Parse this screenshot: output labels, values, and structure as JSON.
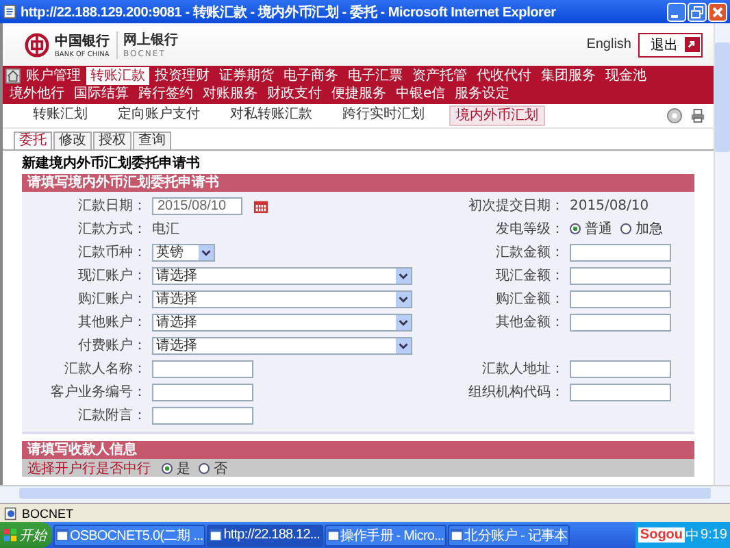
{
  "window": {
    "title": "http://22.188.129.200:9081 - 转账汇款 - 境内外币汇划 - 委托 - Microsoft Internet Explorer"
  },
  "header": {
    "logo_text": "中国银行",
    "logo_subtext": "BANK OF CHINA",
    "product": "网上银行",
    "product_en": "BOCNET",
    "language": "English",
    "logout": "退出"
  },
  "nav": [
    {
      "label": "账户管理",
      "selected": false
    },
    {
      "label": "转账汇款",
      "selected": true
    },
    {
      "label": "投资理财",
      "selected": false
    },
    {
      "label": "证券期货",
      "selected": false
    },
    {
      "label": "电子商务",
      "selected": false
    },
    {
      "label": "电子汇票",
      "selected": false
    },
    {
      "label": "资产托管",
      "selected": false
    },
    {
      "label": "代收代付",
      "selected": false
    },
    {
      "label": "集团服务",
      "selected": false
    },
    {
      "label": "现金池",
      "selected": false
    },
    {
      "label": "境外他行",
      "selected": false
    },
    {
      "label": "国际结算",
      "selected": false
    },
    {
      "label": "跨行签约",
      "selected": false
    },
    {
      "label": "对账服务",
      "selected": false
    },
    {
      "label": "财政支付",
      "selected": false
    },
    {
      "label": "便捷服务",
      "selected": false
    },
    {
      "label": "中银e信",
      "selected": false
    },
    {
      "label": "服务设定",
      "selected": false
    }
  ],
  "subnav": [
    {
      "label": "转账汇划",
      "selected": false
    },
    {
      "label": "定向账户支付",
      "selected": false
    },
    {
      "label": "对私转账汇款",
      "selected": false
    },
    {
      "label": "跨行实时汇划",
      "selected": false
    },
    {
      "label": "境内外币汇划",
      "selected": true
    }
  ],
  "tabs": [
    {
      "label": "委托",
      "selected": true
    },
    {
      "label": "修改",
      "selected": false
    },
    {
      "label": "授权",
      "selected": false
    },
    {
      "label": "查询",
      "selected": false
    }
  ],
  "form": {
    "heading": "新建境内外币汇划委托申请书",
    "section": "请填写境内外币汇划委托申请书",
    "rows": [
      {
        "left": {
          "label": "汇款日期：",
          "kind": "date",
          "value": "2015/08/10"
        },
        "right": {
          "label": "初次提交日期：",
          "kind": "text",
          "value": "2015/08/10"
        }
      },
      {
        "left": {
          "label": "汇款方式：",
          "kind": "text",
          "value": "电汇"
        },
        "right": {
          "label": "发电等级：",
          "kind": "radio",
          "options": [
            {
              "label": "普通",
              "selected": true
            },
            {
              "label": "加急",
              "selected": false
            }
          ]
        }
      },
      {
        "left": {
          "label": "汇款币种：",
          "kind": "short_select",
          "value": "英镑"
        },
        "right": {
          "label": "汇款金额：",
          "kind": "input"
        }
      },
      {
        "left": {
          "label": "现汇账户：",
          "kind": "select",
          "value": "请选择"
        },
        "right": {
          "label": "现汇金额：",
          "kind": "input"
        }
      },
      {
        "left": {
          "label": "购汇账户：",
          "kind": "select",
          "value": "请选择"
        },
        "right": {
          "label": "购汇金额：",
          "kind": "input"
        }
      },
      {
        "left": {
          "label": "其他账户：",
          "kind": "select",
          "value": "请选择"
        },
        "right": {
          "label": "其他金额：",
          "kind": "input"
        }
      },
      {
        "left": {
          "label": "付费账户：",
          "kind": "select",
          "value": "请选择"
        }
      },
      {
        "left": {
          "label": "汇款人名称：",
          "kind": "input"
        },
        "right": {
          "label": "汇款人地址：",
          "kind": "input"
        }
      },
      {
        "left": {
          "label": "客户业务编号：",
          "kind": "input"
        },
        "right": {
          "label": "组织机构代码：",
          "kind": "input"
        }
      },
      {
        "left": {
          "label": "汇款附言：",
          "kind": "input"
        }
      }
    ]
  },
  "payee": {
    "section": "请填写收款人信息",
    "question": "选择开户行是否中行",
    "options": [
      {
        "label": "是",
        "selected": true
      },
      {
        "label": "否",
        "selected": false
      }
    ]
  },
  "status_bar": {
    "text": "BOCNET"
  },
  "taskbar": {
    "start": "开始",
    "tasks": [
      {
        "label": "OSBOCNET5.0(二期 ...",
        "selected": false
      },
      {
        "label": "http://22.188.12...",
        "selected": true
      },
      {
        "label": "操作手册 - Micro...",
        "selected": false
      },
      {
        "label": "北分账户 - 记事本",
        "selected": false
      }
    ],
    "ime": "Sogou",
    "ime_mode": "中",
    "time": "9:19"
  }
}
